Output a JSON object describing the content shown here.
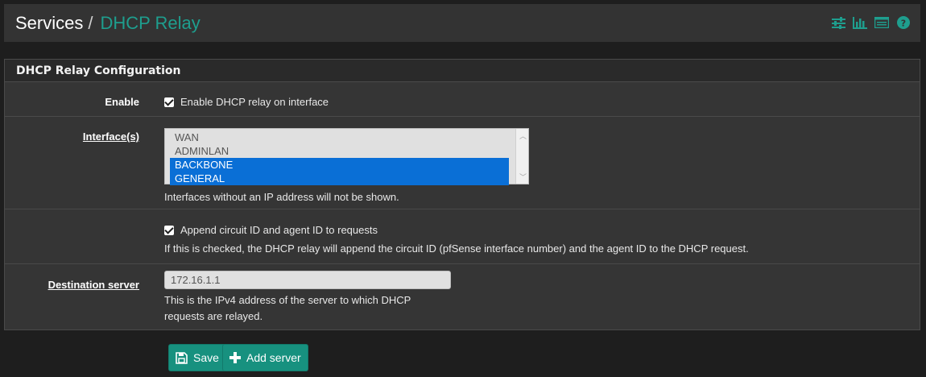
{
  "breadcrumb": {
    "section": "Services",
    "separator": "/",
    "current": "DHCP Relay",
    "icons": [
      "sliders-icon",
      "bar-chart-icon",
      "list-icon",
      "help-icon"
    ]
  },
  "panel": {
    "title": "DHCP Relay Configuration",
    "enable": {
      "label": "Enable",
      "checked": true,
      "checkbox_label": "Enable DHCP relay on interface"
    },
    "interfaces": {
      "label": "Interface(s)",
      "options": [
        {
          "label": "WAN",
          "selected": false
        },
        {
          "label": "ADMINLAN",
          "selected": false
        },
        {
          "label": "BACKBONE",
          "selected": true
        },
        {
          "label": "GENERAL",
          "selected": true
        }
      ],
      "help": "Interfaces without an IP address will not be shown."
    },
    "agent_option": {
      "checked": true,
      "checkbox_label": "Append circuit ID and agent ID to requests",
      "help": "If this is checked, the DHCP relay will append the circuit ID (pfSense interface number) and the agent ID to the DHCP request."
    },
    "destination": {
      "label": "Destination server",
      "value": "172.16.1.1",
      "help_line1": "This is the IPv4 address of the server to which DHCP",
      "help_line2": "requests are relayed."
    }
  },
  "buttons": {
    "save": "Save",
    "add_server": "Add server"
  },
  "colors": {
    "accent": "#1e9e8e",
    "button": "#17917f",
    "selected_option": "#0a6fd6"
  }
}
